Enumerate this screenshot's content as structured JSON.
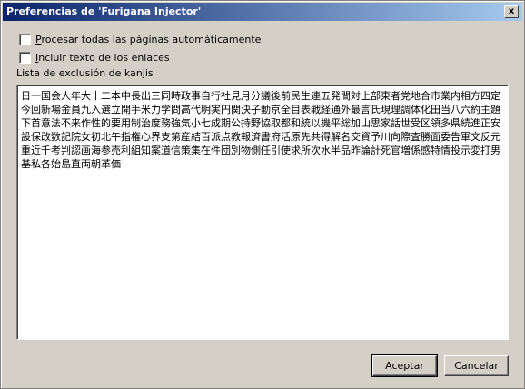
{
  "window": {
    "title": "Preferencias de 'Furigana Injector'",
    "close_glyph": "x"
  },
  "options": [
    {
      "label_first": "P",
      "label_rest": "rocesar todas las páginas automáticamente",
      "checked": false
    },
    {
      "label_first": "I",
      "label_rest": "ncluir texto de los enlaces",
      "checked": false
    }
  ],
  "exclusion": {
    "label": "Lista de exclusión de kanjis",
    "value": "日一国会人年大十二本中長出三同時政事自行社見月分議後前民生連五発間対上部東者党地合市業内相方四定今回新場金員九入選立開手米力学問高代明実円関決子動京全目表戦経通外最言氏現理調体化田当八六約主題下首意法不来作性的要用制治度務強気小七成期公持野協取都和統以機平総加山思家話世受区領多県続進正安設保改数記院女初北午指権心界支第産結百派点教報済書府活原先共得解名交資予川向際査勝面委告軍文反元重近千考判認画海参売利組知案道信策集在件団別物側任引使求所次水半品昨論計死官増係感特情投示変打男基私各始島直両朝革価"
  },
  "buttons": {
    "ok": "Aceptar",
    "cancel": "Cancelar"
  }
}
